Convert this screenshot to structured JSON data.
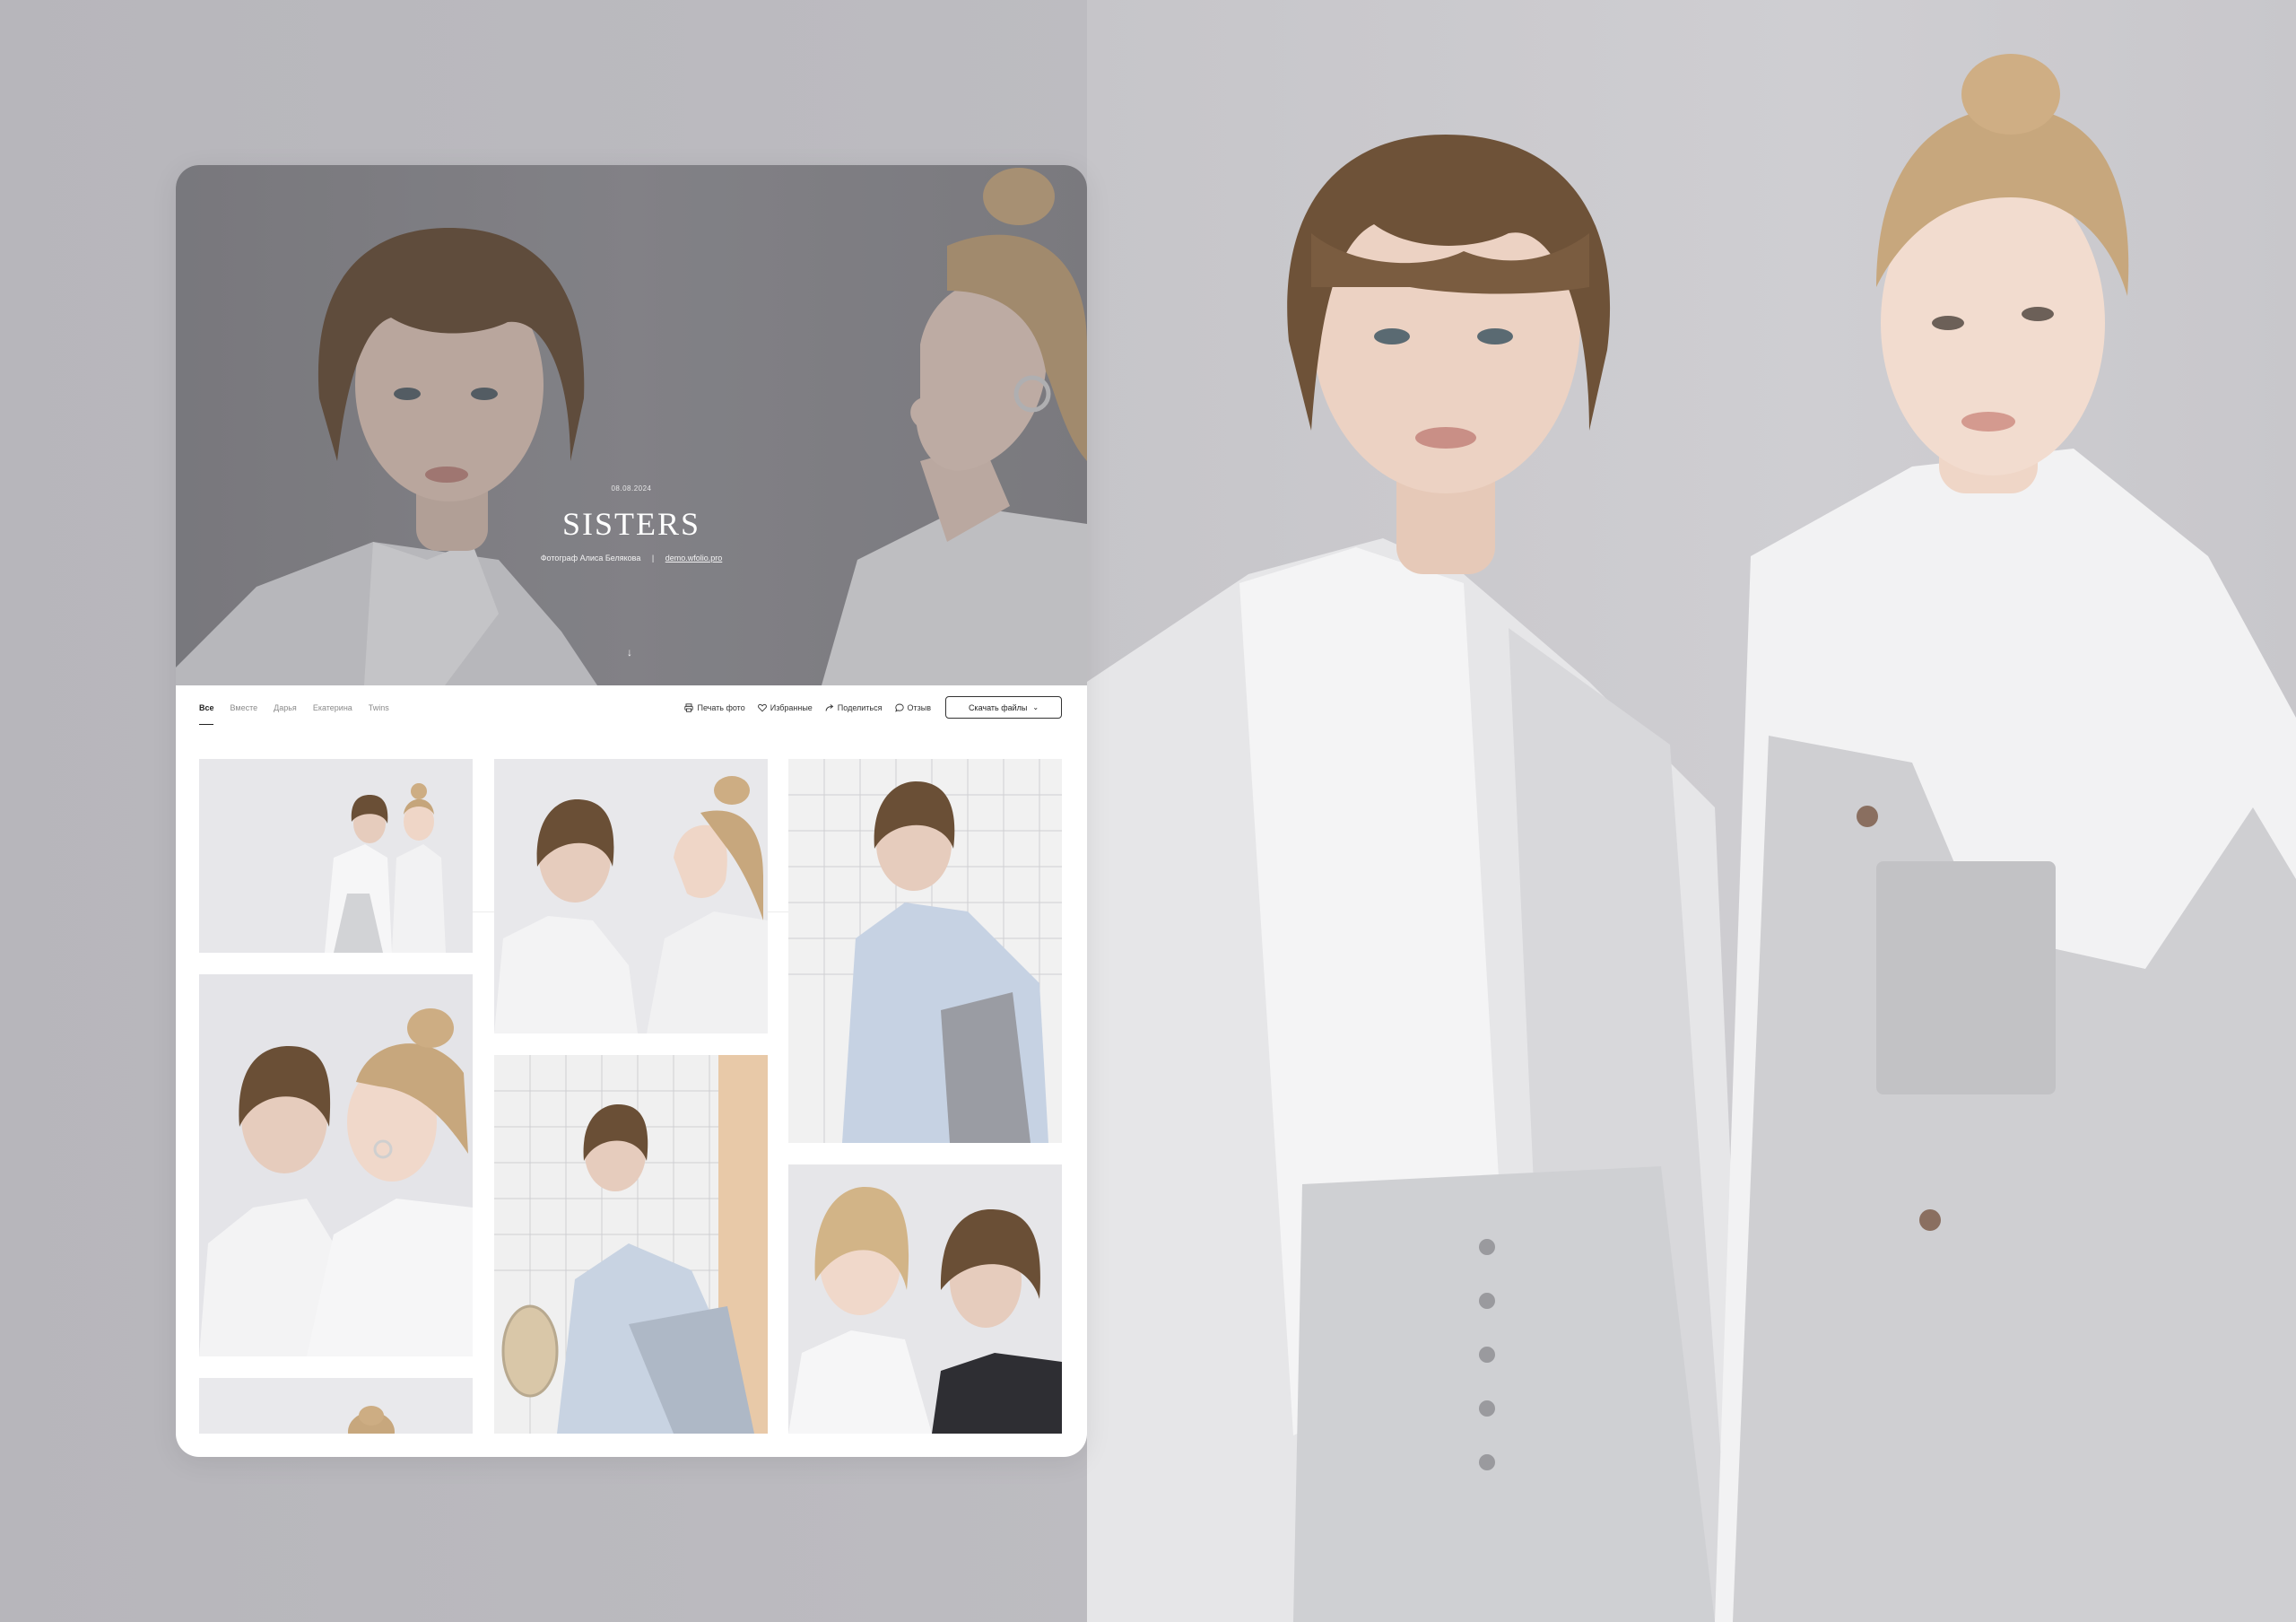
{
  "cover": {
    "date": "08.08.2024",
    "title": "SISTERS",
    "photographer": "Фотограф Алиса Белякова",
    "separator": "|",
    "site_link": "demo.wfolio.pro",
    "scroll_icon": "arrow-down-icon"
  },
  "tabs": [
    {
      "label": "Все",
      "active": true
    },
    {
      "label": "Вместе",
      "active": false
    },
    {
      "label": "Дарья",
      "active": false
    },
    {
      "label": "Екатерина",
      "active": false
    },
    {
      "label": "Twins",
      "active": false
    }
  ],
  "actions": {
    "print": {
      "label": "Печать фото",
      "icon": "printer-icon"
    },
    "favorites": {
      "label": "Избранные",
      "icon": "heart-icon"
    },
    "share": {
      "label": "Поделиться",
      "icon": "share-arrow-icon"
    },
    "review": {
      "label": "Отзыв",
      "icon": "chat-bubble-icon"
    },
    "download": {
      "label": "Скачать файлы",
      "icon": "chevron-down-icon"
    }
  },
  "colors": {
    "page_background": "#bcbbc0",
    "card_background": "#ffffff",
    "text_primary": "#222222",
    "text_muted": "#8a8a8a"
  }
}
